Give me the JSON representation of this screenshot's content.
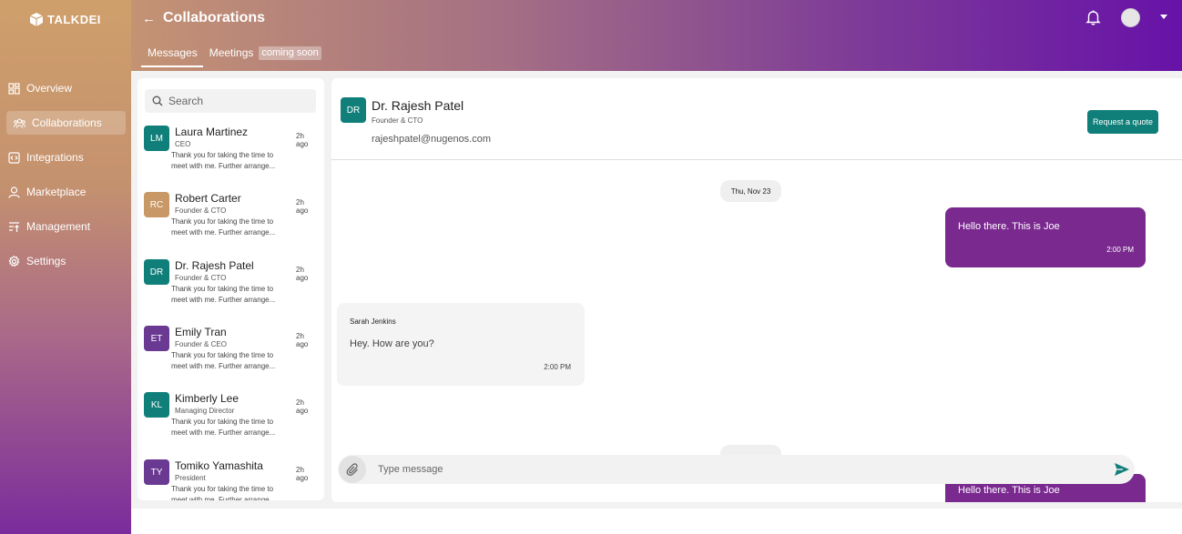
{
  "app": {
    "logo_text": "TALKDEI"
  },
  "sidebar": {
    "items": [
      {
        "label": "Overview",
        "icon": "grid-icon"
      },
      {
        "label": "Collaborations",
        "icon": "users-icon"
      },
      {
        "label": "Integrations",
        "icon": "code-icon"
      },
      {
        "label": "Marketplace",
        "icon": "person-icon"
      },
      {
        "label": "Management",
        "icon": "sort-icon"
      },
      {
        "label": "Settings",
        "icon": "gear-icon"
      }
    ],
    "active_index": 1
  },
  "header": {
    "back": "←",
    "title": "Collaborations",
    "tabs": [
      {
        "label": "Messages"
      },
      {
        "label": "Meetings"
      }
    ],
    "badge": "coming soon"
  },
  "search": {
    "placeholder": "Search"
  },
  "contacts": [
    {
      "initials": "LM",
      "name": "Laura Martinez",
      "role": "CEO",
      "time": "2h ago",
      "preview": "Thank you for taking the time to meet with me. Further arrange...",
      "color": "#107f7a"
    },
    {
      "initials": "RC",
      "name": "Robert Carter",
      "role": "Founder & CTO",
      "time": "2h ago",
      "preview": "Thank you for taking the time to meet with me. Further arrange...",
      "color": "#c89866"
    },
    {
      "initials": "DR",
      "name": "Dr. Rajesh Patel",
      "role": "Founder & CTO",
      "time": "2h ago",
      "preview": "Thank you for taking the time to meet with me. Further arrange...",
      "color": "#107f7a"
    },
    {
      "initials": "ET",
      "name": "Emily Tran",
      "role": "Founder & CEO",
      "time": "2h ago",
      "preview": "Thank you for taking the time to meet with me. Further arrange...",
      "color": "#6a3a93"
    },
    {
      "initials": "KL",
      "name": "Kimberly Lee",
      "role": "Managing Director",
      "time": "2h ago",
      "preview": "Thank you for taking the time to meet with me. Further arrange...",
      "color": "#107f7a"
    },
    {
      "initials": "TY",
      "name": "Tomiko Yamashita",
      "role": "President",
      "time": "2h ago",
      "preview": "Thank you for taking the time to meet with me. Further arrange...",
      "color": "#6a3a93"
    }
  ],
  "chat": {
    "initials": "DR",
    "name": "Dr. Rajesh Patel",
    "role": "Founder & CTO",
    "email": "rajeshpatel@nugenos.com",
    "quote_button": "Request a quote",
    "date1": "Thu, Nov 23",
    "out1": {
      "text": "Hello there. This is Joe",
      "time": "2:00 PM"
    },
    "in1": {
      "sender": "Sarah Jenkins",
      "text": "Hey. How are you?",
      "time": "2:00 PM"
    },
    "out2": {
      "text": "Hello there. This is Joe"
    }
  },
  "composer": {
    "placeholder": "Type message"
  },
  "colors": {
    "accent": "#107f7a",
    "bubble_out": "#7a2a8f"
  }
}
